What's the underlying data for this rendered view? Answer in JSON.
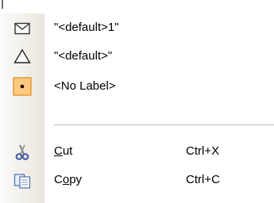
{
  "menu": {
    "items": [
      {
        "icon": "envelope-icon",
        "label": "\"<default>1\""
      },
      {
        "icon": "triangle-icon",
        "label": "\"<default>\""
      },
      {
        "icon": "selected-dot-icon",
        "label": "<No Label>"
      }
    ],
    "edit_items": [
      {
        "icon": "cut-scissors-icon",
        "label_prefix": "",
        "label_mnemonic": "C",
        "label_rest": "ut",
        "shortcut": "Ctrl+X"
      },
      {
        "icon": "copy-icon",
        "label_prefix": "C",
        "label_mnemonic": "o",
        "label_rest": "py",
        "shortcut": "Ctrl+C"
      }
    ]
  },
  "colors": {
    "gutter": "#f1efe8",
    "selected_box_fill": "#ffc980",
    "selected_box_border": "#e29a3c"
  }
}
